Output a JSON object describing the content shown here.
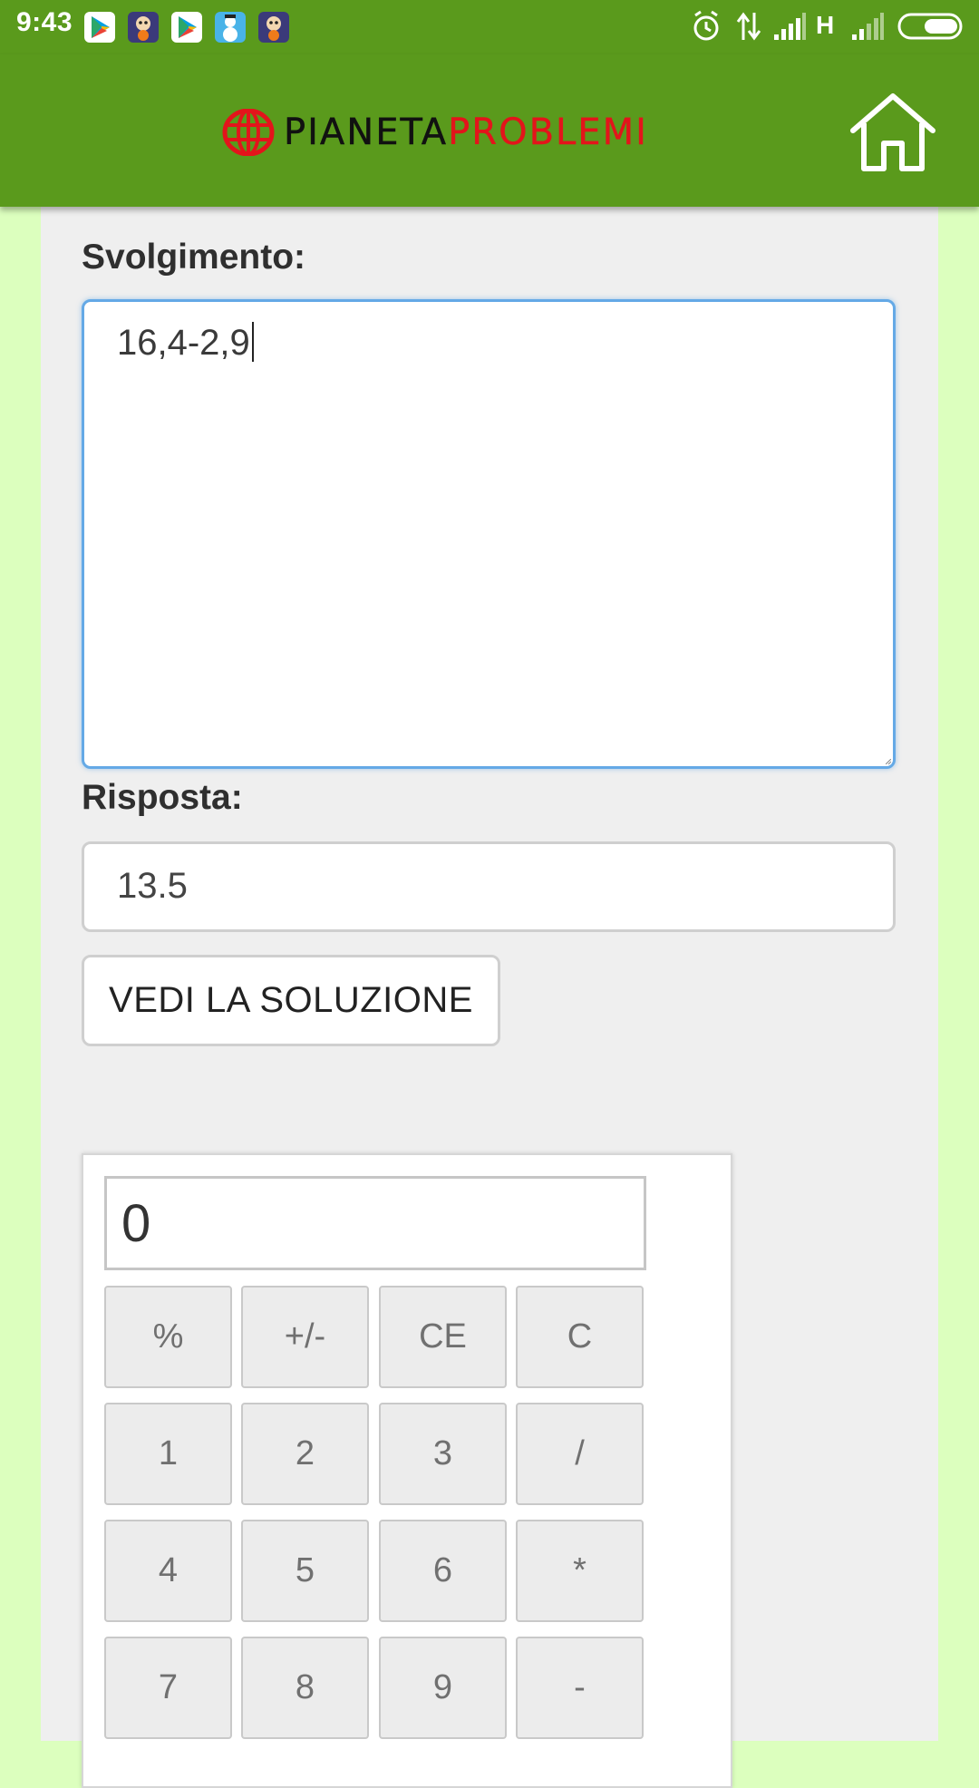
{
  "status_bar": {
    "time": "9:43",
    "network_type": "H",
    "notification_icons": [
      "play-store-icon",
      "game-app-icon",
      "play-store-icon",
      "snowman-app-icon",
      "game-app-icon"
    ],
    "status_icons": [
      "alarm-icon",
      "data-transfer-icon",
      "signal-icon",
      "signal-icon",
      "battery-icon"
    ]
  },
  "app_bar": {
    "logo_part1": "PIANETA",
    "logo_part2": "PROBLEMI",
    "home_icon": "home-icon",
    "colors": {
      "bar": "#5a9a1c",
      "logo_dark": "#111111",
      "logo_red": "#e3141b"
    }
  },
  "form": {
    "working_label": "Svolgimento:",
    "working_value": "16,4-2,9",
    "answer_label": "Risposta:",
    "answer_value": "13.5",
    "solution_button": "VEDI LA SOLUZIONE"
  },
  "calculator": {
    "display": "0",
    "keys": [
      [
        "%",
        "+/-",
        "CE",
        "C"
      ],
      [
        "1",
        "2",
        "3",
        "/"
      ],
      [
        "4",
        "5",
        "6",
        "*"
      ],
      [
        "7",
        "8",
        "9",
        "-"
      ]
    ]
  },
  "colors": {
    "page_background": "#dcffbe",
    "panel_background": "#efefef",
    "focus_border": "#64a9e6"
  }
}
